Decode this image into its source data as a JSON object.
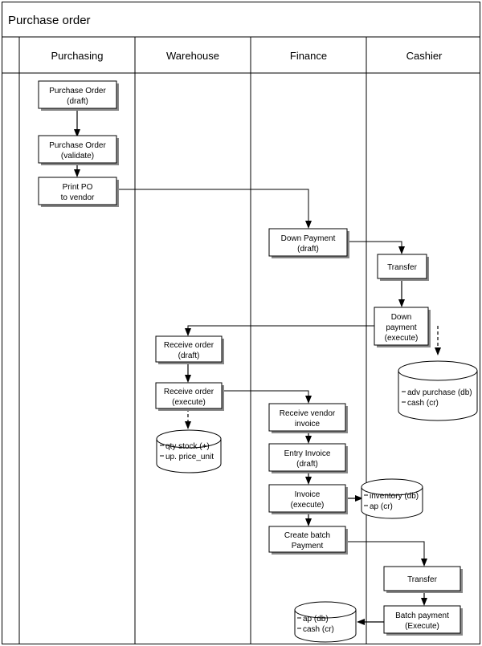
{
  "diagram": {
    "title": "Purchase order",
    "lanes": [
      {
        "id": "purchasing",
        "label": "Purchasing"
      },
      {
        "id": "warehouse",
        "label": "Warehouse"
      },
      {
        "id": "finance",
        "label": "Finance"
      },
      {
        "id": "cashier",
        "label": "Cashier"
      }
    ],
    "colors": {
      "stroke": "#000000",
      "fill": "#ffffff",
      "shadow": "#888888",
      "background": "#ffffff"
    },
    "nodes": [
      {
        "id": "po-draft",
        "lane": "purchasing",
        "type": "process",
        "line1": "Purchase Order",
        "line2": "(draft)"
      },
      {
        "id": "po-validate",
        "lane": "purchasing",
        "type": "process",
        "line1": "Purchase Order",
        "line2": "(validate)"
      },
      {
        "id": "print-po",
        "lane": "purchasing",
        "type": "process",
        "line1": "Print PO",
        "line2": "to vendor"
      },
      {
        "id": "down-payment-draft",
        "lane": "finance",
        "type": "process",
        "line1": "Down Payment",
        "line2": "(draft)"
      },
      {
        "id": "transfer-1",
        "lane": "cashier",
        "type": "process",
        "line1": "Transfer",
        "line2": ""
      },
      {
        "id": "down-payment-execute",
        "lane": "cashier",
        "type": "process",
        "line1": "Down",
        "line2": "payment",
        "line3": "(execute)"
      },
      {
        "id": "receive-order-draft",
        "lane": "warehouse",
        "type": "process",
        "line1": "Receive order",
        "line2": "(draft)"
      },
      {
        "id": "receive-order-execute",
        "lane": "warehouse",
        "type": "process",
        "line1": "Receive order",
        "line2": "(execute)"
      },
      {
        "id": "receive-vendor-invoice",
        "lane": "finance",
        "type": "process",
        "line1": "Receive vendor",
        "line2": "invoice"
      },
      {
        "id": "entry-invoice-draft",
        "lane": "finance",
        "type": "process",
        "line1": "Entry Invoice",
        "line2": "(draft)"
      },
      {
        "id": "invoice-execute",
        "lane": "finance",
        "type": "process",
        "line1": "Invoice",
        "line2": "(execute)"
      },
      {
        "id": "create-batch-payment",
        "lane": "finance",
        "type": "process",
        "line1": "Create batch",
        "line2": "Payment"
      },
      {
        "id": "transfer-2",
        "lane": "cashier",
        "type": "process",
        "line1": "Transfer",
        "line2": ""
      },
      {
        "id": "batch-payment-execute",
        "lane": "cashier",
        "type": "process",
        "line1": "Batch payment",
        "line2": "(Execute)"
      }
    ],
    "datastores": [
      {
        "id": "db-adv-purchase",
        "lane": "cashier",
        "line1": "adv purchase (db)",
        "line2": "cash (cr)"
      },
      {
        "id": "db-qty-stock",
        "lane": "warehouse",
        "line1": "qty stock (+)",
        "line2": "up. price_unit"
      },
      {
        "id": "db-inventory",
        "lane": "finance",
        "line1": "inventory (db)",
        "line2": "ap (cr)"
      },
      {
        "id": "db-ap-cash",
        "lane": "finance",
        "line1": "ap (db)",
        "line2": "cash (cr)"
      }
    ]
  }
}
